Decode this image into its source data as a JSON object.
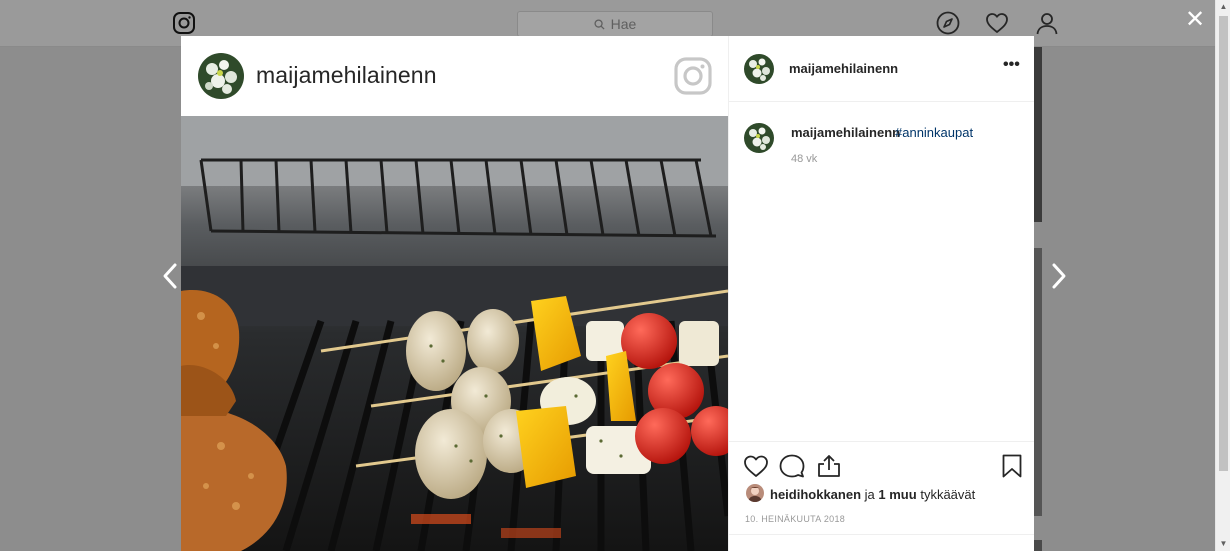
{
  "header": {
    "search_placeholder": "Hae"
  },
  "post": {
    "username": "maijamehilainenn",
    "caption_user": "maijamehilainenn",
    "caption_hashtag": "#anninkaupat",
    "caption_time": "48 vk",
    "likes_user": "heidihokkanen",
    "likes_conjunction": "ja",
    "likes_count_text": "1 muu",
    "likes_suffix": "tykkäävät",
    "date": "10. HEINÄKUUTA 2018"
  },
  "controls": {
    "close_glyph": "✕",
    "more_glyph": "•••"
  },
  "icons": [
    "instagram-logo-icon",
    "search-icon",
    "compass-icon",
    "heart-icon",
    "profile-icon",
    "close-icon",
    "chevron-left-icon",
    "chevron-right-icon",
    "instagram-glyph-icon",
    "more-options-icon",
    "like-heart-icon",
    "comment-icon",
    "share-icon",
    "bookmark-icon"
  ],
  "colors": {
    "hashtag": "#003569",
    "overlay": "#8d8d8d",
    "text": "#262626",
    "muted": "#999999"
  }
}
